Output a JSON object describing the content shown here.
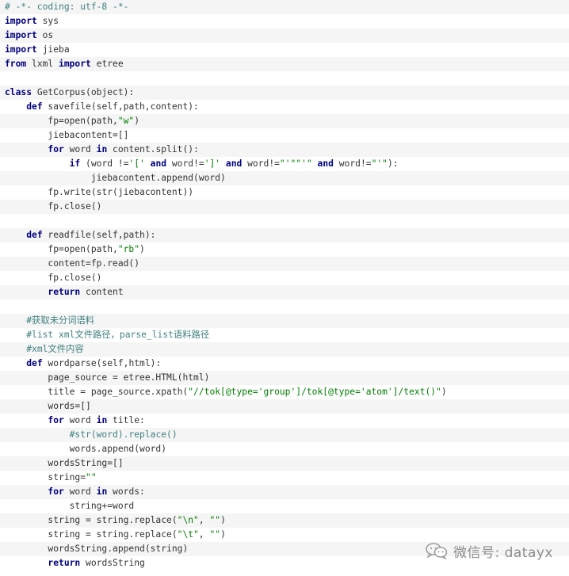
{
  "code_lines": [
    [
      [
        "c",
        "# -*- coding: utf-8 -*-"
      ]
    ],
    [
      [
        "k",
        "import"
      ],
      [
        "t",
        " sys"
      ]
    ],
    [
      [
        "k",
        "import"
      ],
      [
        "t",
        " os"
      ]
    ],
    [
      [
        "k",
        "import"
      ],
      [
        "t",
        " jieba"
      ]
    ],
    [
      [
        "k",
        "from"
      ],
      [
        "t",
        " lxml "
      ],
      [
        "k",
        "import"
      ],
      [
        "t",
        " etree"
      ]
    ],
    [],
    [
      [
        "k",
        "class"
      ],
      [
        "t",
        " GetCorpus(object):"
      ]
    ],
    [
      [
        "t",
        "    "
      ],
      [
        "k",
        "def"
      ],
      [
        "t",
        " savefile(self,path,content):"
      ]
    ],
    [
      [
        "t",
        "        fp=open(path,"
      ],
      [
        "s",
        "\"w\""
      ],
      [
        "t",
        ")"
      ]
    ],
    [
      [
        "t",
        "        jiebacontent=[]"
      ]
    ],
    [
      [
        "t",
        "        "
      ],
      [
        "k",
        "for"
      ],
      [
        "t",
        " word "
      ],
      [
        "k",
        "in"
      ],
      [
        "t",
        " content.split():"
      ]
    ],
    [
      [
        "t",
        "            "
      ],
      [
        "k",
        "if"
      ],
      [
        "t",
        " (word !="
      ],
      [
        "s",
        "'['"
      ],
      [
        "t",
        " "
      ],
      [
        "k",
        "and"
      ],
      [
        "t",
        " word!="
      ],
      [
        "s",
        "']'"
      ],
      [
        "t",
        " "
      ],
      [
        "k",
        "and"
      ],
      [
        "t",
        " word!="
      ],
      [
        "s",
        "\"'\"\"'\""
      ],
      [
        "t",
        " "
      ],
      [
        "k",
        "and"
      ],
      [
        "t",
        " word!="
      ],
      [
        "s",
        "\"'\""
      ],
      [
        "t",
        "):"
      ]
    ],
    [
      [
        "t",
        "                jiebacontent.append(word)"
      ]
    ],
    [
      [
        "t",
        "        fp.write(str(jiebacontent))"
      ]
    ],
    [
      [
        "t",
        "        fp.close()"
      ]
    ],
    [],
    [
      [
        "t",
        "    "
      ],
      [
        "k",
        "def"
      ],
      [
        "t",
        " readfile(self,path):"
      ]
    ],
    [
      [
        "t",
        "        fp=open(path,"
      ],
      [
        "s",
        "\"rb\""
      ],
      [
        "t",
        ")"
      ]
    ],
    [
      [
        "t",
        "        content=fp.read()"
      ]
    ],
    [
      [
        "t",
        "        fp.close()"
      ]
    ],
    [
      [
        "t",
        "        "
      ],
      [
        "k",
        "return"
      ],
      [
        "t",
        " content"
      ]
    ],
    [],
    [
      [
        "t",
        "    "
      ],
      [
        "c",
        "#获取未分词语料"
      ]
    ],
    [
      [
        "t",
        "    "
      ],
      [
        "c",
        "#list xml文件路径，parse_list语料路径"
      ]
    ],
    [
      [
        "t",
        "    "
      ],
      [
        "c",
        "#xml文件内容"
      ]
    ],
    [
      [
        "t",
        "    "
      ],
      [
        "k",
        "def"
      ],
      [
        "t",
        " wordparse(self,html):"
      ]
    ],
    [
      [
        "t",
        "        page_source = etree.HTML(html)"
      ]
    ],
    [
      [
        "t",
        "        title = page_source.xpath("
      ],
      [
        "s",
        "\"//tok[@type='group']/tok[@type='atom']/text()\""
      ],
      [
        "t",
        ")"
      ]
    ],
    [
      [
        "t",
        "        words=[]"
      ]
    ],
    [
      [
        "t",
        "        "
      ],
      [
        "k",
        "for"
      ],
      [
        "t",
        " word "
      ],
      [
        "k",
        "in"
      ],
      [
        "t",
        " title:"
      ]
    ],
    [
      [
        "t",
        "            "
      ],
      [
        "c",
        "#str(word).replace()"
      ]
    ],
    [
      [
        "t",
        "            words.append(word)"
      ]
    ],
    [
      [
        "t",
        "        wordsString=[]"
      ]
    ],
    [
      [
        "t",
        "        string="
      ],
      [
        "s",
        "\"\""
      ]
    ],
    [
      [
        "t",
        "        "
      ],
      [
        "k",
        "for"
      ],
      [
        "t",
        " word "
      ],
      [
        "k",
        "in"
      ],
      [
        "t",
        " words:"
      ]
    ],
    [
      [
        "t",
        "            string+=word"
      ]
    ],
    [
      [
        "t",
        "        string = string.replace("
      ],
      [
        "s",
        "\"\\n\""
      ],
      [
        "t",
        ", "
      ],
      [
        "s",
        "\"\""
      ],
      [
        "t",
        ")"
      ]
    ],
    [
      [
        "t",
        "        string = string.replace("
      ],
      [
        "s",
        "\"\\t\""
      ],
      [
        "t",
        ", "
      ],
      [
        "s",
        "\"\""
      ],
      [
        "t",
        ")"
      ]
    ],
    [
      [
        "t",
        "        wordsString.append(string)"
      ]
    ],
    [
      [
        "t",
        "        "
      ],
      [
        "k",
        "return"
      ],
      [
        "t",
        " wordsString"
      ]
    ]
  ],
  "watermark": {
    "icon": "wechat-icon",
    "text": "微信号: datayx"
  },
  "colors": {
    "keyword": "#000080",
    "string": "#008000",
    "comment": "#408080",
    "text": "#333333",
    "stripe": "#f5f5f5",
    "background": "#ffffff"
  }
}
